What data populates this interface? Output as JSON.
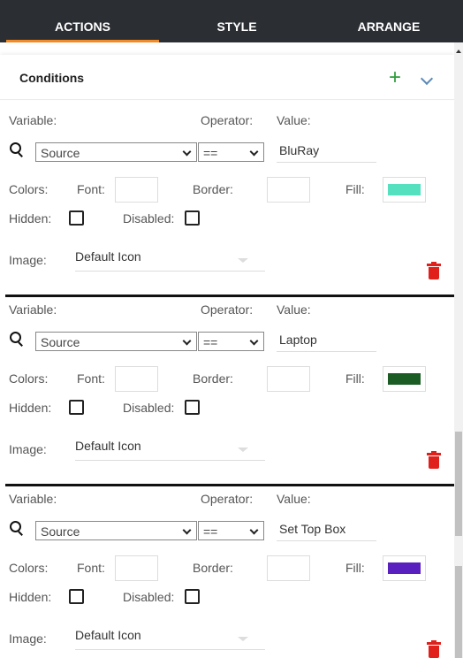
{
  "tabs": [
    "ACTIONS",
    "STYLE",
    "ARRANGE"
  ],
  "active_tab": "ACTIONS",
  "section": {
    "title": "Conditions",
    "add_icon": "plus-icon",
    "collapse_icon": "chevron-down-icon"
  },
  "colors": {
    "accent": "#f28a26",
    "add": "#2e9c3c",
    "delete": "#e0201b"
  },
  "labels": {
    "variable": "Variable:",
    "operator": "Operator:",
    "value": "Value:",
    "colors": "Colors:",
    "font": "Font:",
    "border": "Border:",
    "fill": "Fill:",
    "hidden": "Hidden:",
    "disabled": "Disabled:",
    "image": "Image:"
  },
  "conditions": [
    {
      "variable": "Source",
      "operator": "==",
      "value": "BluRay",
      "font_color": "",
      "border_color": "",
      "fill_color": "#55e0c0",
      "hidden": false,
      "disabled": false,
      "image": "Default Icon"
    },
    {
      "variable": "Source",
      "operator": "==",
      "value": "Laptop",
      "font_color": "",
      "border_color": "",
      "fill_color": "#1a5c24",
      "hidden": false,
      "disabled": false,
      "image": "Default Icon"
    },
    {
      "variable": "Source",
      "operator": "==",
      "value": "Set Top Box",
      "font_color": "",
      "border_color": "",
      "fill_color": "#5a1fbf",
      "hidden": false,
      "disabled": false,
      "image": "Default Icon"
    }
  ]
}
